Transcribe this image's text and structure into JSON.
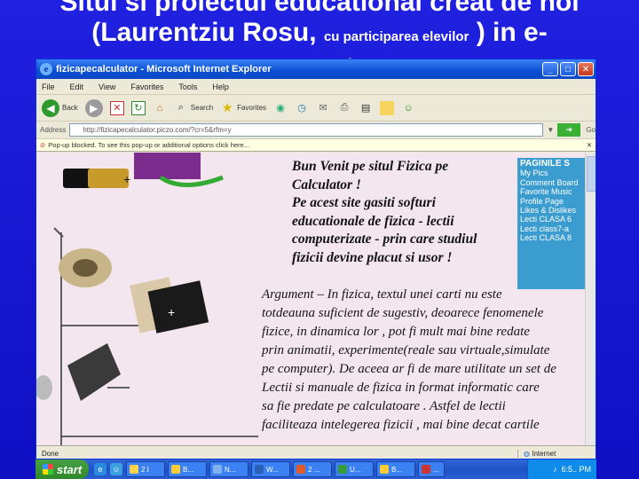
{
  "slide": {
    "title_line1": "Situl si proiectul educational creat de noi",
    "title_line2_a": "(Laurentziu Rosu,",
    "title_line2_small": "cu participarea elevilor",
    "title_line2_b": ") in e-",
    "title_line3": "vacanta"
  },
  "browser": {
    "window_title": "fizicapecalculator - Microsoft Internet Explorer",
    "menu": [
      "File",
      "Edit",
      "View",
      "Favorites",
      "Tools",
      "Help"
    ],
    "toolbar": {
      "back_label": "Back",
      "search_label": "Search",
      "favorites_label": "Favorites"
    },
    "address_label": "Address",
    "address_value": "http://fizicapecalculator.piczo.com/?cr=5&rfm=y",
    "go_label": "Go",
    "popup_message": "Pop-up blocked. To see this pop-up or additional options click here...",
    "status_text": "Done",
    "status_zone": "Internet"
  },
  "page": {
    "welcome_lines": [
      "Bun Venit pe situl Fizica pe",
      "Calculator !",
      "Pe acest site gasiti softuri",
      "educationale de fizica - lectii",
      "computerizate - prin care studiul",
      "fizicii devine placut si usor !"
    ],
    "sidebar_title": "PAGINILE S",
    "sidebar_items": [
      "My Pics",
      "Comment Board",
      "Favorite Music",
      "Profile Page",
      "Likes & Dislikes",
      "Lecti CLASA 6",
      "Lecti class7-a",
      "Lecti CLASA 8"
    ],
    "argument_lines": [
      "Argument –   In fizica,  textul unei carti nu este",
      "totdeauna suficient de sugestiv, deoarece fenomenele",
      "fizice, in dinamica lor , pot fi mult mai bine redate",
      "prin animatii, experimente(reale sau virtuale,simulate",
      "pe computer). De aceea ar fi de mare utilitate un set de",
      "Lectii si manuale de fizica in format informatic care",
      "sa fie predate pe calculatoare . Astfel de lectii",
      "faciliteaza intelegerea fizicii , mai bine decat cartile"
    ],
    "battery_plus": "+"
  },
  "taskbar": {
    "start_label": "start",
    "tasks": [
      "2 I",
      "B...",
      "N...",
      "W...",
      "2 ...",
      "U...",
      "B...",
      "..."
    ],
    "clock": "6:5.. PM"
  }
}
